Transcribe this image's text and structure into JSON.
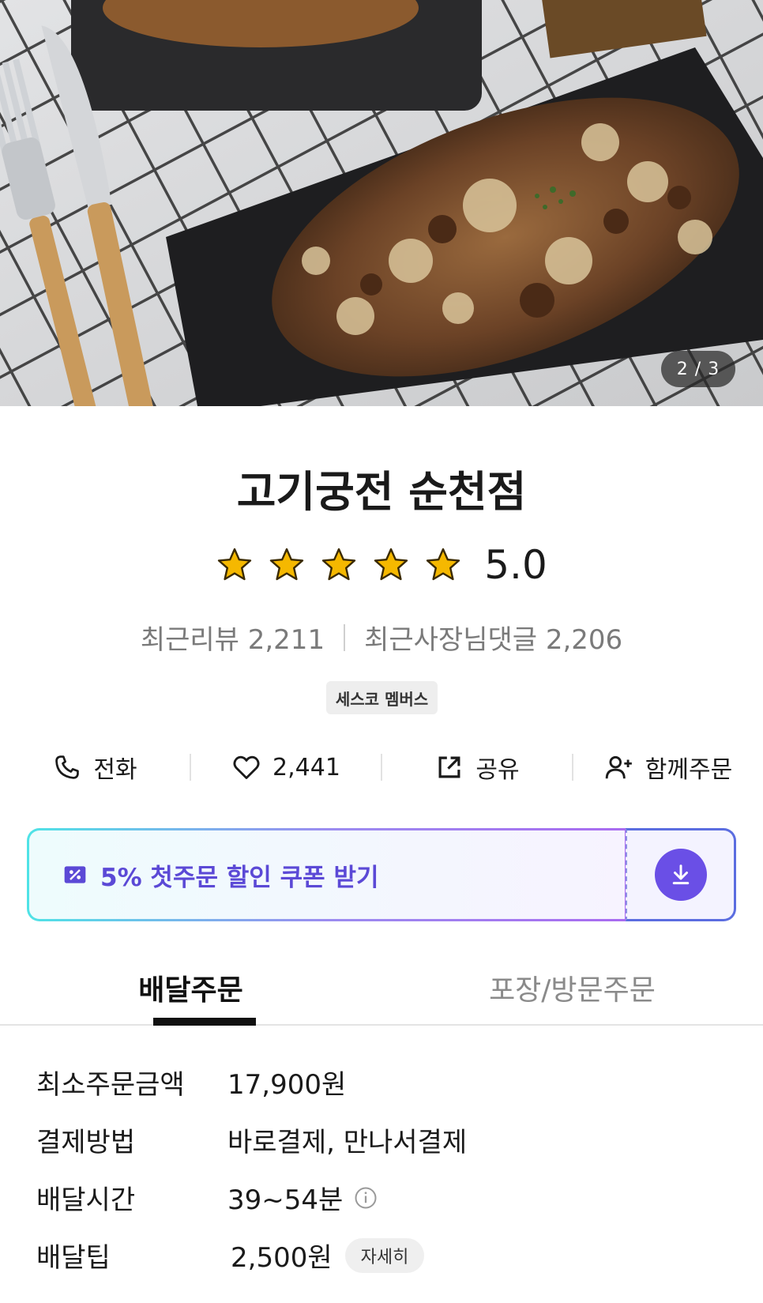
{
  "hero": {
    "counter": "2 / 3"
  },
  "store": {
    "name": "고기궁전 순천점",
    "rating": "5.0",
    "star_count": 5,
    "recent_reviews": "최근리뷰 2,211",
    "owner_replies": "최근사장님댓글 2,206",
    "badge": "세스코 멤버스"
  },
  "actions": {
    "call": "전화",
    "likes": "2,441",
    "share": "공유",
    "group_order": "함께주문"
  },
  "coupon": {
    "text": "5% 첫주문 할인 쿠폰 받기"
  },
  "tabs": {
    "delivery": "배달주문",
    "pickup": "포장/방문주문"
  },
  "info": {
    "min_order_label": "최소주문금액",
    "min_order_value": "17,900원",
    "payment_label": "결제방법",
    "payment_value": "바로결제, 만나서결제",
    "time_label": "배달시간",
    "time_value": "39~54분",
    "tip_label": "배달팁",
    "tip_value": "2,500원",
    "tip_detail": "자세히"
  },
  "colors": {
    "coupon_text": "#5b49d6",
    "download_button": "#6a4fe6",
    "star": "#f5b800"
  }
}
